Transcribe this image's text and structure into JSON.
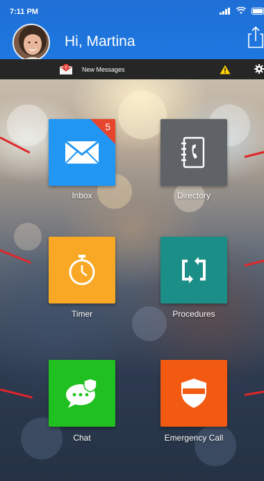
{
  "status_bar": {
    "time": "7:11 PM"
  },
  "header": {
    "greeting": "Hi, Martina"
  },
  "message_bar": {
    "unread_count": "6",
    "label": "New Messages"
  },
  "tiles": [
    {
      "label": "Inbox",
      "color": "#2196f3",
      "badge": "5"
    },
    {
      "label": "Directory",
      "color": "#5f6368"
    },
    {
      "label": "Timer",
      "color": "#f9a825"
    },
    {
      "label": "Procedures",
      "color": "#1b8f87"
    },
    {
      "label": "Chat",
      "color": "#21c021"
    },
    {
      "label": "Emergency Call",
      "color": "#f25a12"
    }
  ],
  "colors": {
    "header": "#1e78e0",
    "message_bar": "#262626",
    "badge": "#e8452e",
    "warning": "#ffd400",
    "pointer": "#e0262a"
  },
  "icons": [
    "signal-icon",
    "wifi-icon",
    "battery-icon",
    "share-icon",
    "mail-icon",
    "warning-icon",
    "gear-icon",
    "envelope-icon",
    "address-book-icon",
    "stopwatch-icon",
    "sync-icon",
    "chat-bubble-icon",
    "security-badge-icon"
  ]
}
